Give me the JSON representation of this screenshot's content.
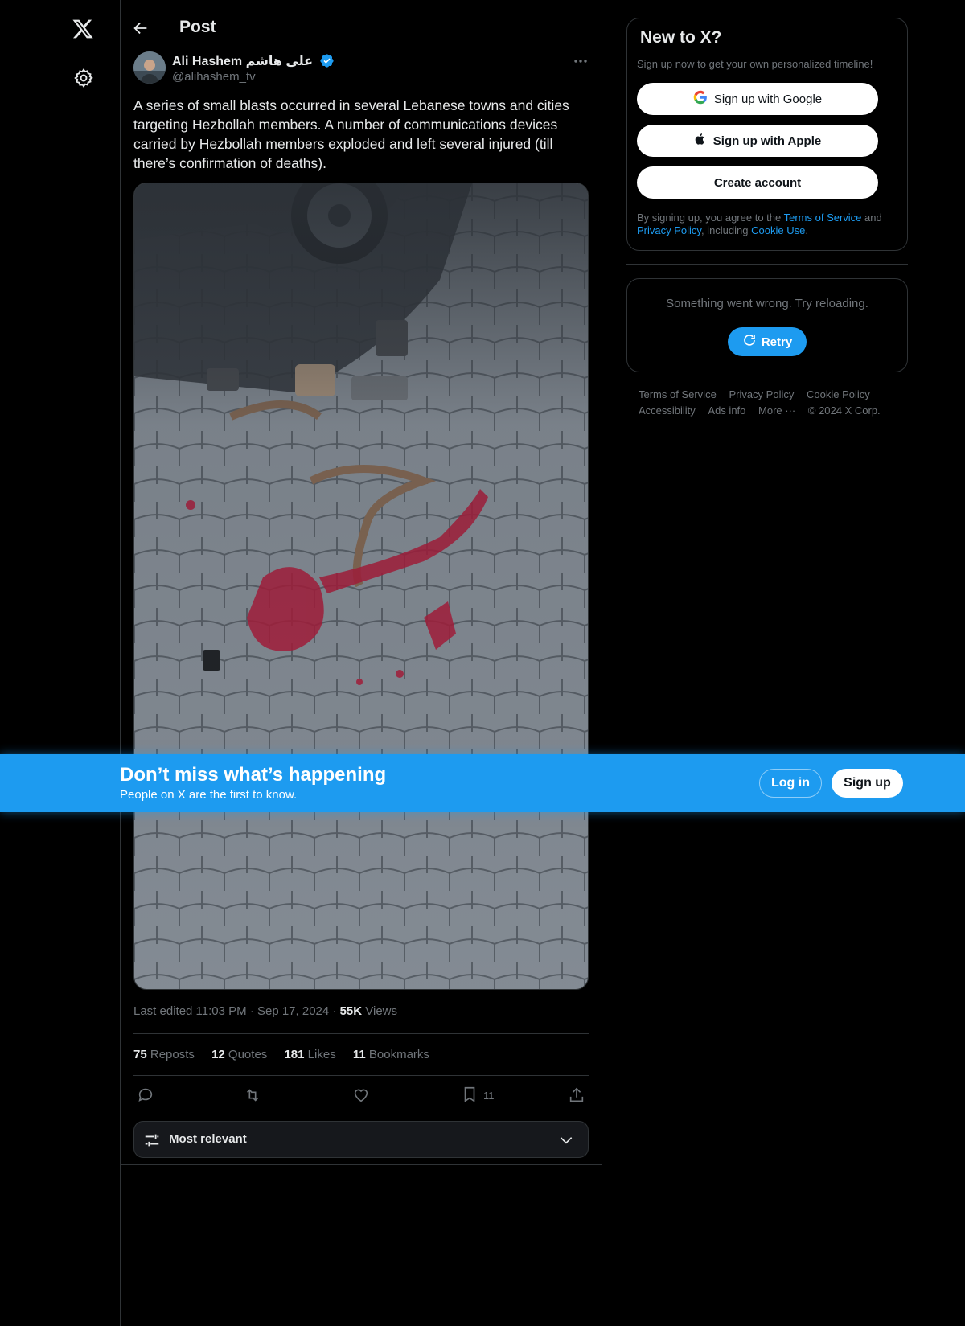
{
  "header": {
    "title": "Post"
  },
  "tweet": {
    "author_name": "Ali Hashem علي هاشم",
    "author_handle": "@alihashem_tv",
    "text": "A series of small blasts occurred in several Lebanese towns and cities targeting Hezbollah members. A number of communications devices carried by Hezbollah members exploded and left several injured (till there’s confirmation of deaths).",
    "edited_label": "Last edited 11:03 PM · Sep 17, 2024 · ",
    "views_count": "55K",
    "views_label": " Views",
    "stats": {
      "reposts_count": "75",
      "reposts_label": "Reposts",
      "quotes_count": "12",
      "quotes_label": "Quotes",
      "likes_count": "181",
      "likes_label": "Likes",
      "bookmarks_count": "11",
      "bookmarks_label": "Bookmarks"
    },
    "actions": {
      "bookmark_count": "11"
    },
    "sort_label": "Most relevant"
  },
  "signup": {
    "title": "New to X?",
    "subtitle": "Sign up now to get your own personalized timeline!",
    "google_label": "Sign up with Google",
    "apple_label": "Sign up with Apple",
    "create_label": "Create account",
    "legal_prefix": "By signing up, you agree to the ",
    "terms_link": "Terms of Service",
    "legal_and": " and ",
    "privacy_link": "Privacy Policy",
    "legal_including": ", including ",
    "cookie_link": "Cookie Use",
    "legal_end": "."
  },
  "error_card": {
    "message": "Something went wrong. Try reloading.",
    "retry_label": "Retry"
  },
  "footer": {
    "links": [
      "Terms of Service",
      "Privacy Policy",
      "Cookie Policy",
      "Accessibility",
      "Ads info",
      "More ···",
      "© 2024 X Corp."
    ]
  },
  "banner": {
    "title": "Don’t miss what’s happening",
    "subtitle": "People on X are the first to know.",
    "login_label": "Log in",
    "signup_label": "Sign up"
  },
  "colors": {
    "accent": "#1d9bf0",
    "background": "#000000",
    "text_primary": "#e7e9ea",
    "text_secondary": "#71767b",
    "border": "#2f3336"
  },
  "icons": {
    "logo": "x-logo-icon",
    "settings": "gear-icon",
    "back": "arrow-left-icon",
    "verified": "verified-badge-icon",
    "more": "more-horizontal-icon",
    "reply": "reply-icon",
    "repost": "repost-icon",
    "like": "heart-icon",
    "bookmark": "bookmark-icon",
    "share": "share-icon",
    "sort": "sliders-icon",
    "chevron": "chevron-down-icon",
    "google": "google-icon",
    "apple": "apple-icon",
    "retry": "refresh-icon"
  }
}
